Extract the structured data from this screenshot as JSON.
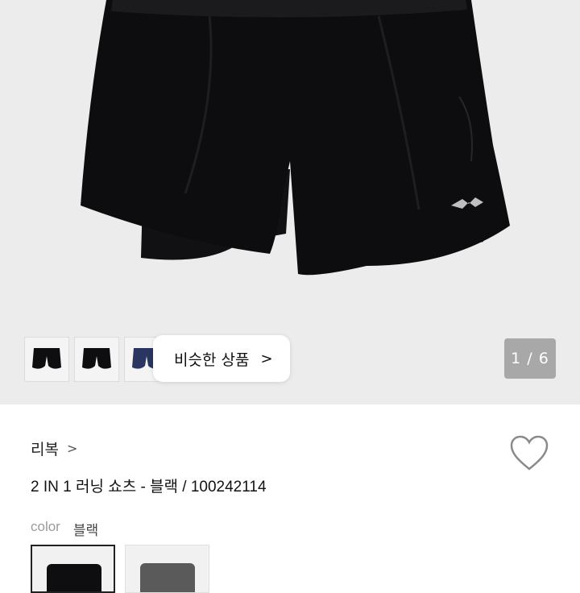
{
  "gallery": {
    "similar_button_label": "비슷한 상품",
    "similar_button_chevron": ">",
    "counter": "1 / 6",
    "thumbnails": [
      "black-shorts-front",
      "black-shorts-back",
      "navy-shorts"
    ]
  },
  "product": {
    "brand": "리복",
    "brand_chevron": ">",
    "title": "2 IN 1 러닝 쇼츠 - 블랙 / 100242114",
    "color_label": "color",
    "color_value": "블랙"
  },
  "colors": {
    "black": "#0e0e10",
    "grey": "#5a5a5a",
    "navy": "#2a3560"
  }
}
